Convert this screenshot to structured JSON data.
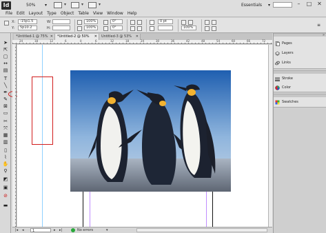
{
  "app": {
    "logo": "Id",
    "zoom": "50%",
    "workspace": "Essentials",
    "menu": [
      "File",
      "Edit",
      "Layout",
      "Type",
      "Object",
      "Table",
      "View",
      "Window",
      "Help"
    ]
  },
  "control_bar": {
    "x_label": "X:",
    "y_label": "Y:",
    "x_value": "-15p1.5",
    "y_value": "5p10.2",
    "w_label": "W:",
    "h_label": "H:",
    "scale_x": "100%",
    "scale_y": "100%",
    "rotate": "0°",
    "shear": "0°",
    "stroke_weight": "0 pt",
    "frame_zoom": "100%"
  },
  "tabs": [
    {
      "label": "*Untitled-1 @ 75%",
      "active": false
    },
    {
      "label": "*Untitled-2 @ 50%",
      "active": true
    },
    {
      "label": "Untitled-3 @ 53%",
      "active": false
    }
  ],
  "ruler": {
    "top": [
      "24",
      "18",
      "12",
      "6",
      "0",
      "6",
      "12",
      "18",
      "24",
      "30",
      "36",
      "42",
      "48",
      "54",
      "60",
      "66",
      "72"
    ]
  },
  "panels": {
    "group1": [
      "Pages",
      "Layers",
      "Links"
    ],
    "group2": [
      "Stroke",
      "Color"
    ],
    "group3": [
      "Swatches"
    ]
  },
  "status": {
    "page": "1",
    "preflight": "No errors"
  },
  "colors": {
    "selection_red": "#d11a1a",
    "guide_blue": "#8fd0ff",
    "margin_purple": "#c08cff",
    "status_green": "#28a83a"
  }
}
